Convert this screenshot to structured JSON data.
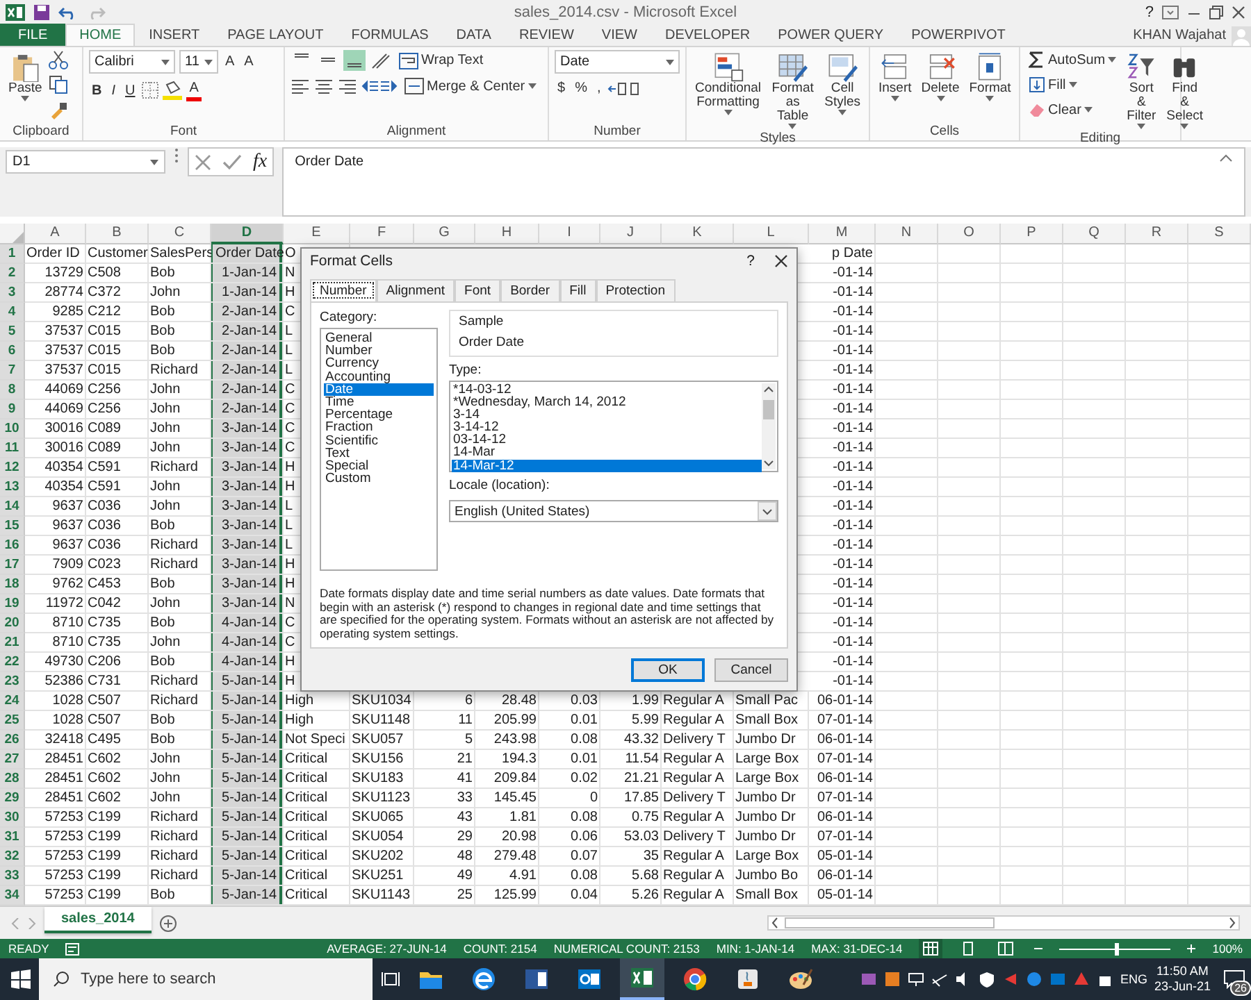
{
  "window": {
    "title": "sales_2014.csv - Microsoft Excel",
    "user": "KHAN Wajahat",
    "help": "?"
  },
  "tabs": [
    {
      "label": "FILE",
      "kind": "file",
      "selected": false
    },
    {
      "label": "HOME",
      "kind": "tab",
      "selected": true
    },
    {
      "label": "INSERT",
      "kind": "tab",
      "selected": false
    },
    {
      "label": "PAGE LAYOUT",
      "kind": "tab",
      "selected": false
    },
    {
      "label": "FORMULAS",
      "kind": "tab",
      "selected": false
    },
    {
      "label": "DATA",
      "kind": "tab",
      "selected": false
    },
    {
      "label": "REVIEW",
      "kind": "tab",
      "selected": false
    },
    {
      "label": "VIEW",
      "kind": "tab",
      "selected": false
    },
    {
      "label": "DEVELOPER",
      "kind": "tab",
      "selected": false
    },
    {
      "label": "POWER QUERY",
      "kind": "tab",
      "selected": false
    },
    {
      "label": "POWERPIVOT",
      "kind": "tab",
      "selected": false
    }
  ],
  "ribbon": {
    "clipboard": {
      "paste": "Paste",
      "label": "Clipboard"
    },
    "font": {
      "name": "Calibri",
      "size": "11",
      "grow": "A",
      "shrink": "A",
      "styles": [
        {
          "label": "B",
          "kind": "bold"
        },
        {
          "label": "I",
          "kind": "italic"
        },
        {
          "label": "U",
          "kind": "underline"
        }
      ],
      "color_letter": "A",
      "label": "Font"
    },
    "alignment": {
      "vertical": [
        {
          "selected": false
        },
        {
          "selected": false
        },
        {
          "selected": true
        }
      ],
      "wrap": "Wrap Text",
      "merge": "Merge & Center",
      "label": "Alignment"
    },
    "number": {
      "format": "Date",
      "symbols": [
        "$",
        "%",
        ","
      ],
      "label": "Number"
    },
    "styles": {
      "buttons": [
        {
          "label": "Conditional Formatting",
          "kind": "conditional"
        },
        {
          "label": "Format as Table",
          "kind": "table"
        },
        {
          "label": "Cell Styles",
          "kind": "styles"
        }
      ],
      "label": "Styles"
    },
    "cells": {
      "buttons": [
        {
          "label": "Insert",
          "kind": "insert"
        },
        {
          "label": "Delete",
          "kind": "delete"
        },
        {
          "label": "Format",
          "kind": "format"
        }
      ],
      "label": "Cells"
    },
    "editing": {
      "small": [
        {
          "label": "AutoSum",
          "kind": "sum"
        },
        {
          "label": "Fill",
          "kind": "fill"
        },
        {
          "label": "Clear",
          "kind": "clear"
        }
      ],
      "buttons": [
        {
          "label": "Sort & Filter",
          "kind": "sort"
        },
        {
          "label": "Find & Select",
          "kind": "find"
        }
      ],
      "label": "Editing"
    }
  },
  "formula_bar": {
    "name_box": "D1",
    "fx": "fx",
    "formula": "Order Date"
  },
  "columns": [
    {
      "label": "A",
      "selected": false
    },
    {
      "label": "B",
      "selected": false
    },
    {
      "label": "C",
      "selected": false
    },
    {
      "label": "D",
      "selected": true
    },
    {
      "label": "E",
      "selected": false
    },
    {
      "label": "F",
      "selected": false
    },
    {
      "label": "G",
      "selected": false
    },
    {
      "label": "H",
      "selected": false
    },
    {
      "label": "I",
      "selected": false
    },
    {
      "label": "J",
      "selected": false
    },
    {
      "label": "K",
      "selected": false
    },
    {
      "label": "L",
      "selected": false
    },
    {
      "label": "M",
      "selected": false
    },
    {
      "label": "N",
      "selected": false
    },
    {
      "label": "O",
      "selected": false
    },
    {
      "label": "P",
      "selected": false
    },
    {
      "label": "Q",
      "selected": false
    },
    {
      "label": "R",
      "selected": false
    },
    {
      "label": "S",
      "selected": false
    }
  ],
  "rows": [
    {
      "number": "1",
      "kind": "header",
      "cells": [
        "Order ID",
        "Customer",
        "SalesPers",
        "Order Date",
        "O"
      ],
      "last_cell": "p Date"
    },
    {
      "number": "2",
      "kind": "data",
      "cells": [
        "13729",
        "C508",
        "Bob",
        "1-Jan-14",
        "N"
      ],
      "last_cell": "-01-14"
    },
    {
      "number": "3",
      "kind": "data",
      "cells": [
        "28774",
        "C372",
        "John",
        "1-Jan-14",
        "H"
      ],
      "last_cell": "-01-14"
    },
    {
      "number": "4",
      "kind": "data",
      "cells": [
        "9285",
        "C212",
        "Bob",
        "2-Jan-14",
        "C"
      ],
      "last_cell": "-01-14"
    },
    {
      "number": "5",
      "kind": "data",
      "cells": [
        "37537",
        "C015",
        "Bob",
        "2-Jan-14",
        "L"
      ],
      "last_cell": "-01-14"
    },
    {
      "number": "6",
      "kind": "data",
      "cells": [
        "37537",
        "C015",
        "Bob",
        "2-Jan-14",
        "L"
      ],
      "last_cell": "-01-14"
    },
    {
      "number": "7",
      "kind": "data",
      "cells": [
        "37537",
        "C015",
        "Richard",
        "2-Jan-14",
        "L"
      ],
      "last_cell": "-01-14"
    },
    {
      "number": "8",
      "kind": "data",
      "cells": [
        "44069",
        "C256",
        "John",
        "2-Jan-14",
        "C"
      ],
      "last_cell": "-01-14"
    },
    {
      "number": "9",
      "kind": "data",
      "cells": [
        "44069",
        "C256",
        "John",
        "2-Jan-14",
        "C"
      ],
      "last_cell": "-01-14"
    },
    {
      "number": "10",
      "kind": "data",
      "cells": [
        "30016",
        "C089",
        "John",
        "3-Jan-14",
        "C"
      ],
      "last_cell": "-01-14"
    },
    {
      "number": "11",
      "kind": "data",
      "cells": [
        "30016",
        "C089",
        "John",
        "3-Jan-14",
        "C"
      ],
      "last_cell": "-01-14"
    },
    {
      "number": "12",
      "kind": "data",
      "cells": [
        "40354",
        "C591",
        "Richard",
        "3-Jan-14",
        "H"
      ],
      "last_cell": "-01-14"
    },
    {
      "number": "13",
      "kind": "data",
      "cells": [
        "40354",
        "C591",
        "John",
        "3-Jan-14",
        "H"
      ],
      "last_cell": "-01-14"
    },
    {
      "number": "14",
      "kind": "data",
      "cells": [
        "9637",
        "C036",
        "John",
        "3-Jan-14",
        "L"
      ],
      "last_cell": "-01-14"
    },
    {
      "number": "15",
      "kind": "data",
      "cells": [
        "9637",
        "C036",
        "Bob",
        "3-Jan-14",
        "L"
      ],
      "last_cell": "-01-14"
    },
    {
      "number": "16",
      "kind": "data",
      "cells": [
        "9637",
        "C036",
        "Richard",
        "3-Jan-14",
        "L"
      ],
      "last_cell": "-01-14"
    },
    {
      "number": "17",
      "kind": "data",
      "cells": [
        "7909",
        "C023",
        "Richard",
        "3-Jan-14",
        "H"
      ],
      "last_cell": "-01-14"
    },
    {
      "number": "18",
      "kind": "data",
      "cells": [
        "9762",
        "C453",
        "Bob",
        "3-Jan-14",
        "H"
      ],
      "last_cell": "-01-14"
    },
    {
      "number": "19",
      "kind": "data",
      "cells": [
        "11972",
        "C042",
        "John",
        "3-Jan-14",
        "N"
      ],
      "last_cell": "-01-14"
    },
    {
      "number": "20",
      "kind": "data",
      "cells": [
        "8710",
        "C735",
        "Bob",
        "4-Jan-14",
        "C"
      ],
      "last_cell": "-01-14"
    },
    {
      "number": "21",
      "kind": "data",
      "cells": [
        "8710",
        "C735",
        "John",
        "4-Jan-14",
        "C"
      ],
      "last_cell": "-01-14"
    },
    {
      "number": "22",
      "kind": "data",
      "cells": [
        "49730",
        "C206",
        "Bob",
        "4-Jan-14",
        "H"
      ],
      "last_cell": "-01-14"
    },
    {
      "number": "23",
      "kind": "data",
      "cells": [
        "52386",
        "C731",
        "Richard",
        "5-Jan-14",
        "H"
      ],
      "last_cell": "-01-14"
    },
    {
      "number": "24",
      "kind": "data",
      "cells": [
        "1028",
        "C507",
        "Richard",
        "5-Jan-14",
        "High",
        "SKU1034",
        "6",
        "28.48",
        "0.03",
        "1.99",
        "Regular A",
        "Small Pac",
        "06-01-14"
      ]
    },
    {
      "number": "25",
      "kind": "data",
      "cells": [
        "1028",
        "C507",
        "Bob",
        "5-Jan-14",
        "High",
        "SKU1148",
        "11",
        "205.99",
        "0.01",
        "5.99",
        "Regular A",
        "Small Box",
        "07-01-14"
      ]
    },
    {
      "number": "26",
      "kind": "data",
      "cells": [
        "32418",
        "C495",
        "Bob",
        "5-Jan-14",
        "Not Speci",
        "SKU057",
        "5",
        "243.98",
        "0.08",
        "43.32",
        "Delivery T",
        "Jumbo Dr",
        "06-01-14"
      ]
    },
    {
      "number": "27",
      "kind": "data",
      "cells": [
        "28451",
        "C602",
        "John",
        "5-Jan-14",
        "Critical",
        "SKU156",
        "21",
        "194.3",
        "0.01",
        "11.54",
        "Regular A",
        "Large Box",
        "07-01-14"
      ]
    },
    {
      "number": "28",
      "kind": "data",
      "cells": [
        "28451",
        "C602",
        "John",
        "5-Jan-14",
        "Critical",
        "SKU183",
        "41",
        "209.84",
        "0.02",
        "21.21",
        "Regular A",
        "Large Box",
        "06-01-14"
      ]
    },
    {
      "number": "29",
      "kind": "data",
      "cells": [
        "28451",
        "C602",
        "John",
        "5-Jan-14",
        "Critical",
        "SKU1123",
        "33",
        "145.45",
        "0",
        "17.85",
        "Delivery T",
        "Jumbo Dr",
        "07-01-14"
      ]
    },
    {
      "number": "30",
      "kind": "data",
      "cells": [
        "57253",
        "C199",
        "Richard",
        "5-Jan-14",
        "Critical",
        "SKU065",
        "43",
        "1.81",
        "0.08",
        "0.75",
        "Regular A",
        "Jumbo Dr",
        "06-01-14"
      ]
    },
    {
      "number": "31",
      "kind": "data",
      "cells": [
        "57253",
        "C199",
        "Richard",
        "5-Jan-14",
        "Critical",
        "SKU054",
        "29",
        "20.98",
        "0.06",
        "53.03",
        "Delivery T",
        "Jumbo Dr",
        "07-01-14"
      ]
    },
    {
      "number": "32",
      "kind": "data",
      "cells": [
        "57253",
        "C199",
        "Richard",
        "5-Jan-14",
        "Critical",
        "SKU202",
        "48",
        "279.48",
        "0.07",
        "35",
        "Regular A",
        "Large Box",
        "05-01-14"
      ]
    },
    {
      "number": "33",
      "kind": "data",
      "cells": [
        "57253",
        "C199",
        "Richard",
        "5-Jan-14",
        "Critical",
        "SKU251",
        "49",
        "4.91",
        "0.08",
        "5.68",
        "Regular A",
        "Jumbo Bo",
        "06-01-14"
      ]
    },
    {
      "number": "34",
      "kind": "data",
      "cells": [
        "57253",
        "C199",
        "Bob",
        "5-Jan-14",
        "Critical",
        "SKU1143",
        "25",
        "125.99",
        "0.04",
        "5.26",
        "Regular A",
        "Small Box",
        "05-01-14"
      ]
    }
  ],
  "dialog": {
    "title": "Format Cells",
    "help": "?",
    "tabs": [
      {
        "label": "Number",
        "selected": true
      },
      {
        "label": "Alignment",
        "selected": false
      },
      {
        "label": "Font",
        "selected": false
      },
      {
        "label": "Border",
        "selected": false
      },
      {
        "label": "Fill",
        "selected": false
      },
      {
        "label": "Protection",
        "selected": false
      }
    ],
    "category_label": "Category:",
    "categories": [
      {
        "label": "General",
        "selected": false
      },
      {
        "label": "Number",
        "selected": false
      },
      {
        "label": "Currency",
        "selected": false
      },
      {
        "label": "Accounting",
        "selected": false
      },
      {
        "label": "Date",
        "selected": true
      },
      {
        "label": "Time",
        "selected": false
      },
      {
        "label": "Percentage",
        "selected": false
      },
      {
        "label": "Fraction",
        "selected": false
      },
      {
        "label": "Scientific",
        "selected": false
      },
      {
        "label": "Text",
        "selected": false
      },
      {
        "label": "Special",
        "selected": false
      },
      {
        "label": "Custom",
        "selected": false
      }
    ],
    "sample_label": "Sample",
    "sample": "Order Date",
    "type_label": "Type:",
    "types": [
      {
        "label": "*14-03-12",
        "selected": false
      },
      {
        "label": "*Wednesday, March 14, 2012",
        "selected": false
      },
      {
        "label": "3-14",
        "selected": false
      },
      {
        "label": "3-14-12",
        "selected": false
      },
      {
        "label": "03-14-12",
        "selected": false
      },
      {
        "label": "14-Mar",
        "selected": false
      },
      {
        "label": "14-Mar-12",
        "selected": true
      }
    ],
    "locale_label": "Locale (location):",
    "locale": "English (United States)",
    "description": "Date formats display date and time serial numbers as date values.  Date formats that begin with an asterisk (*) respond to changes in regional date and time settings that are specified for the operating system. Formats without an asterisk are not affected by operating system settings.",
    "buttons": [
      {
        "label": "OK",
        "kind": "default"
      },
      {
        "label": "Cancel",
        "kind": "normal"
      }
    ]
  },
  "sheets": [
    {
      "label": "sales_2014",
      "selected": true
    }
  ],
  "status_bar": {
    "mode": "READY",
    "stats": [
      "AVERAGE: 27-JUN-14",
      "COUNT: 2154",
      "NUMERICAL COUNT: 2153",
      "MIN: 1-JAN-14",
      "MAX: 31-DEC-14"
    ],
    "views": [
      {
        "selected": true
      },
      {
        "selected": false
      },
      {
        "selected": false
      }
    ],
    "zoom": {
      "level": 0.5,
      "reading": "100%"
    }
  },
  "taskbar": {
    "search": {
      "placeholder": "Type here to search"
    },
    "apps": [
      {
        "kind": "folder",
        "active": false
      },
      {
        "kind": "edge",
        "active": false
      },
      {
        "kind": "word",
        "active": false
      },
      {
        "kind": "outlook",
        "active": false
      },
      {
        "kind": "excel",
        "active": true
      },
      {
        "kind": "chrome",
        "active": false
      },
      {
        "kind": "java",
        "active": false
      },
      {
        "kind": "paint",
        "active": false
      }
    ],
    "language": "ENG",
    "time": "11:50 AM",
    "date": "23-Jun-21",
    "notifications": "26"
  }
}
